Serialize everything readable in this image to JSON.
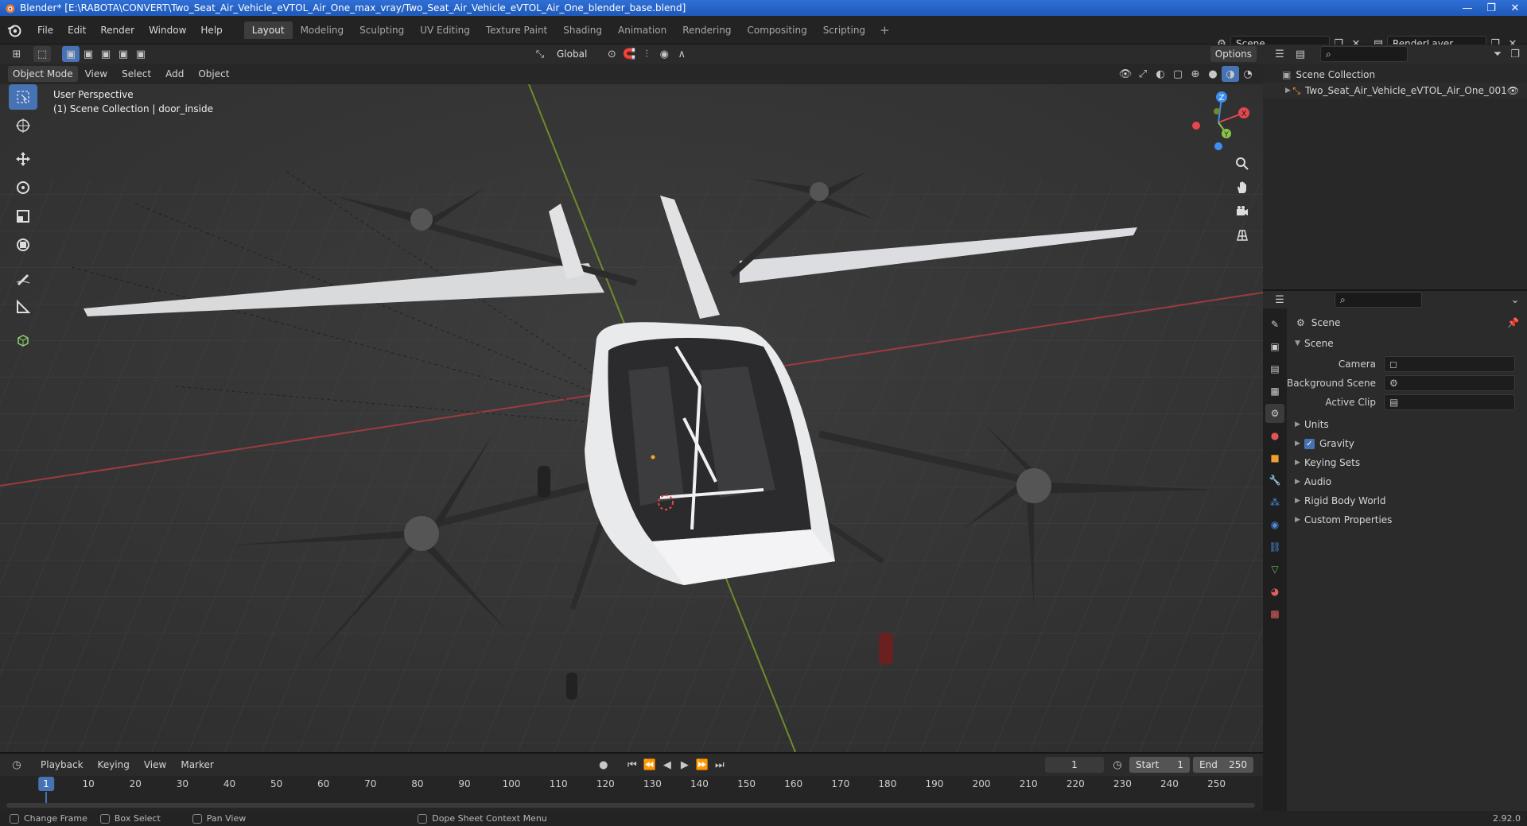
{
  "window": {
    "title": "Blender* [E:\\RABOTA\\CONVERT\\Two_Seat_Air_Vehicle_eVTOL_Air_One_max_vray/Two_Seat_Air_Vehicle_eVTOL_Air_One_blender_base.blend]",
    "minimize": "—",
    "maximize": "❐",
    "close": "✕"
  },
  "menubar": {
    "items": [
      "File",
      "Edit",
      "Render",
      "Window",
      "Help"
    ],
    "workspaces": [
      "Layout",
      "Modeling",
      "Sculpting",
      "UV Editing",
      "Texture Paint",
      "Shading",
      "Animation",
      "Rendering",
      "Compositing",
      "Scripting"
    ],
    "active_workspace": "Layout",
    "add_workspace": "+",
    "scene_name": "Scene",
    "view_layer": "RenderLayer"
  },
  "viewport_header": {
    "transform_orientation": "Global",
    "options_label": "Options"
  },
  "viewport_header2": {
    "mode": "Object Mode",
    "menus": [
      "View",
      "Select",
      "Add",
      "Object"
    ]
  },
  "viewport": {
    "perspective_label": "User Perspective",
    "collection_label": "(1) Scene Collection | door_inside",
    "gizmo_axes": [
      "X",
      "Y",
      "Z"
    ]
  },
  "outliner": {
    "rows": [
      "Scene Collection",
      "Two_Seat_Air_Vehicle_eVTOL_Air_One_001"
    ]
  },
  "properties": {
    "context": "Scene",
    "panel_title": "Scene",
    "fields": [
      {
        "label": "Camera",
        "value": ""
      },
      {
        "label": "Background Scene",
        "value": ""
      },
      {
        "label": "Active Clip",
        "value": ""
      }
    ],
    "subpanels": [
      "Units",
      "Gravity",
      "Keying Sets",
      "Audio",
      "Rigid Body World",
      "Custom Properties"
    ],
    "gravity_checked": true
  },
  "timeline": {
    "menus": [
      "Playback",
      "Keying",
      "View",
      "Marker"
    ],
    "current_frame": "1",
    "start_label": "Start",
    "start_value": "1",
    "end_label": "End",
    "end_value": "250",
    "ruler": [
      "1",
      "10",
      "20",
      "30",
      "40",
      "50",
      "60",
      "70",
      "80",
      "90",
      "100",
      "110",
      "120",
      "130",
      "140",
      "150",
      "160",
      "170",
      "180",
      "190",
      "200",
      "210",
      "220",
      "230",
      "240",
      "250"
    ]
  },
  "statusbar": {
    "items": [
      "Change Frame",
      "Box Select",
      "Pan View",
      "Dope Sheet Context Menu"
    ],
    "version": "2.92.0"
  },
  "colors": {
    "accent": "#4772b3",
    "axis_x": "#e5474e",
    "axis_y": "#8bc34a",
    "axis_z": "#3d8ef0"
  }
}
